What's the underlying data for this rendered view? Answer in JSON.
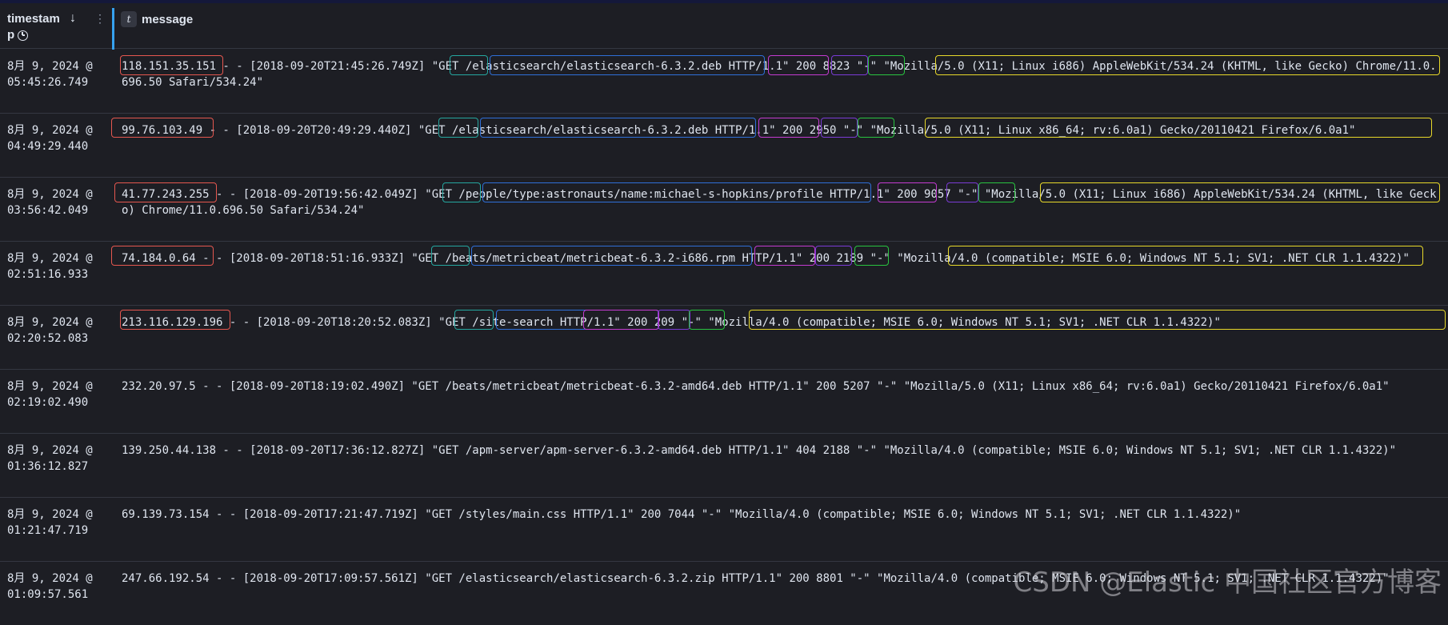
{
  "header": {
    "timestamp_col": "timestam",
    "timestamp_col_line2": "p",
    "message_col": "message",
    "type_badge": "t"
  },
  "rows": [
    {
      "ts1": "8月 9, 2024 @",
      "ts2": "05:45:26.749",
      "message": "118.151.35.151 - - [2018-09-20T21:45:26.749Z] \"GET /elasticsearch/elasticsearch-6.3.2.deb HTTP/1.1\" 200 8823 \"-\" \"Mozilla/5.0 (X11; Linux i686) AppleWebKit/534.24 (KHTML, like Gecko) Chrome/11.0.696.50 Safari/534.24\""
    },
    {
      "ts1": "8月 9, 2024 @",
      "ts2": "04:49:29.440",
      "message": "99.76.103.49 - - [2018-09-20T20:49:29.440Z] \"GET /elasticsearch/elasticsearch-6.3.2.deb HTTP/1.1\" 200 2950 \"-\" \"Mozilla/5.0 (X11; Linux x86_64; rv:6.0a1) Gecko/20110421 Firefox/6.0a1\""
    },
    {
      "ts1": "8月 9, 2024 @",
      "ts2": "03:56:42.049",
      "message": "41.77.243.255 - - [2018-09-20T19:56:42.049Z] \"GET /people/type:astronauts/name:michael-s-hopkins/profile HTTP/1.1\" 200 9057 \"-\" \"Mozilla/5.0 (X11; Linux i686) AppleWebKit/534.24 (KHTML, like Gecko) Chrome/11.0.696.50 Safari/534.24\""
    },
    {
      "ts1": "8月 9, 2024 @",
      "ts2": "02:51:16.933",
      "message": "74.184.0.64 - - [2018-09-20T18:51:16.933Z] \"GET /beats/metricbeat/metricbeat-6.3.2-i686.rpm HTTP/1.1\" 200 2189 \"-\" \"Mozilla/4.0 (compatible; MSIE 6.0; Windows NT 5.1; SV1; .NET CLR 1.1.4322)\""
    },
    {
      "ts1": "8月 9, 2024 @",
      "ts2": "02:20:52.083",
      "message": "213.116.129.196 - - [2018-09-20T18:20:52.083Z] \"GET /site-search HTTP/1.1\" 200 209 \"-\" \"Mozilla/4.0 (compatible; MSIE 6.0; Windows NT 5.1; SV1; .NET CLR 1.1.4322)\""
    },
    {
      "ts1": "8月 9, 2024 @",
      "ts2": "02:19:02.490",
      "message": "232.20.97.5 - - [2018-09-20T18:19:02.490Z] \"GET /beats/metricbeat/metricbeat-6.3.2-amd64.deb HTTP/1.1\" 200 5207 \"-\" \"Mozilla/5.0 (X11; Linux x86_64; rv:6.0a1) Gecko/20110421 Firefox/6.0a1\""
    },
    {
      "ts1": "8月 9, 2024 @",
      "ts2": "01:36:12.827",
      "message": "139.250.44.138 - - [2018-09-20T17:36:12.827Z] \"GET /apm-server/apm-server-6.3.2-amd64.deb HTTP/1.1\" 404 2188 \"-\" \"Mozilla/4.0 (compatible; MSIE 6.0; Windows NT 5.1; SV1; .NET CLR 1.1.4322)\""
    },
    {
      "ts1": "8月 9, 2024 @",
      "ts2": "01:21:47.719",
      "message": "69.139.73.154 - - [2018-09-20T17:21:47.719Z] \"GET /styles/main.css HTTP/1.1\" 200 7044 \"-\" \"Mozilla/4.0 (compatible; MSIE 6.0; Windows NT 5.1; SV1; .NET CLR 1.1.4322)\""
    },
    {
      "ts1": "8月 9, 2024 @",
      "ts2": "01:09:57.561",
      "message": "247.66.192.54 - - [2018-09-20T17:09:57.561Z] \"GET /elasticsearch/elasticsearch-6.3.2.zip HTTP/1.1\" 200 8801 \"-\" \"Mozilla/4.0 (compatible; MSIE 6.0; Windows NT 5.1; SV1; .NET CLR 1.1.4322)\""
    }
  ],
  "watermark": "CSDN @Elastic 中国社区官方博客",
  "colors": {
    "background": "#1d1e24",
    "text": "#dfe5ef",
    "divider_accent": "#36a2ef",
    "highlight_ip": "#e5574f",
    "highlight_method": "#25a7a0",
    "highlight_path": "#2f6fd8",
    "highlight_protocol": "#c43bd1",
    "highlight_status": "#7b3bd6",
    "highlight_bytes": "#29c440",
    "highlight_agent": "#e8d92a"
  }
}
